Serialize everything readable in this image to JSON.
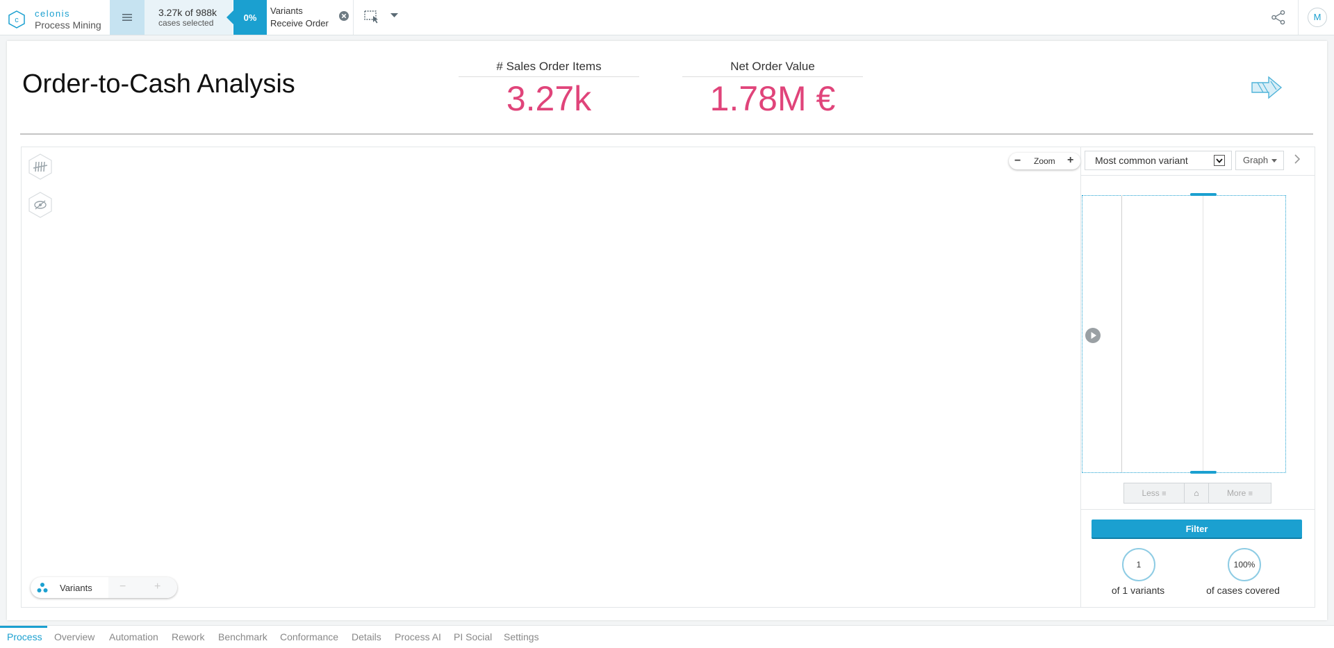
{
  "app": {
    "brand": "celonis",
    "product": "Process Mining"
  },
  "selection": {
    "count": "3.27k of 988k",
    "caption": "cases selected",
    "percent": "0%",
    "filter_type": "Variants",
    "filter_value": "Receive Order"
  },
  "user": {
    "initial": "M"
  },
  "colors": {
    "accent": "#1ba0d0",
    "kpi": "#e0447a"
  },
  "sheet": {
    "title": "Order-to-Cash Analysis",
    "kpis": [
      {
        "label": "# Sales Order Items",
        "value": "3.27k"
      },
      {
        "label": "Net Order Value",
        "value": "1.78M €"
      }
    ]
  },
  "explorer": {
    "zoom_label": "Zoom",
    "variants_label": "Variants",
    "variant_mode": "Most common variant",
    "view_mode": "Graph",
    "less_label": "Less",
    "more_label": "More",
    "filter_label": "Filter",
    "variants_count": "1",
    "variants_caption": "of 1 variants",
    "cases_pct": "100%",
    "cases_caption": "of cases covered"
  },
  "tabs": [
    {
      "label": "Process",
      "active": true
    },
    {
      "label": "Overview"
    },
    {
      "label": "Automation"
    },
    {
      "label": "Rework"
    },
    {
      "label": "Benchmark"
    },
    {
      "label": "Conformance"
    },
    {
      "label": "Details"
    },
    {
      "label": "Process AI"
    },
    {
      "label": "PI Social"
    },
    {
      "label": "Settings"
    }
  ]
}
